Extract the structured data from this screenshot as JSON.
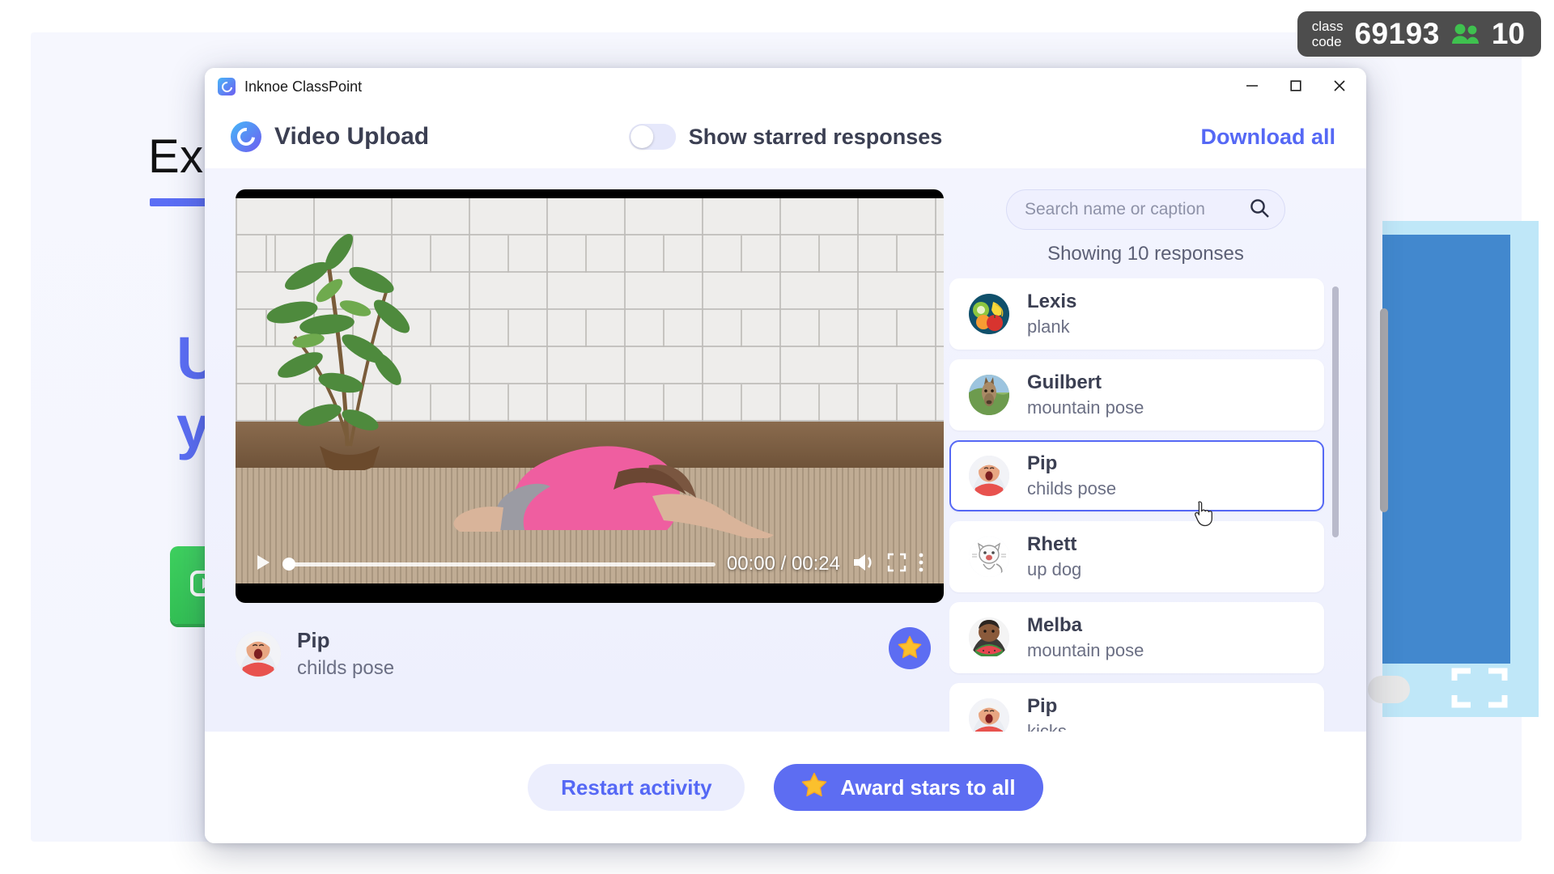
{
  "class_badge": {
    "label_line1": "class",
    "label_line2": "code",
    "code": "69193",
    "participant_icon": "people-icon",
    "participant_count": "10",
    "accent_green": "#3fc14f",
    "background": "#4d4d4d"
  },
  "slide": {
    "title": "Exam",
    "heading": "Up\nyo",
    "video_button_icon": "video-camera-play-icon",
    "accent_blue": "#5b6ef5",
    "green": "#3ed15f",
    "panel_blue": "#4288ce",
    "panel_light_blue": "#bfe7f8",
    "expand_icon": "expand-fullscreen-icon"
  },
  "window": {
    "app_icon": "classpoint-logo-icon",
    "title": "Inknoe ClassPoint",
    "minimize_icon": "minimize-icon",
    "maximize_icon": "maximize-icon",
    "close_icon": "close-icon"
  },
  "header": {
    "activity_icon": "classpoint-logo-icon",
    "activity_title": "Video Upload",
    "toggle_label": "Show starred responses",
    "toggle_state": "off",
    "download_all_label": "Download all",
    "accent": "#5568f5"
  },
  "video": {
    "current_time": "00:00",
    "duration": "00:24",
    "time_display": "00:00 / 00:24",
    "progress_percent": 0,
    "play_icon": "play-icon",
    "volume_icon": "volume-icon",
    "fullscreen_icon": "fullscreen-icon",
    "more_icon": "more-vertical-icon",
    "caption": {
      "avatar": "avatar-pip",
      "name": "Pip",
      "text": "childs pose",
      "star_button_icon": "star-icon"
    }
  },
  "responses_panel": {
    "search_placeholder": "Search name or caption",
    "search_value": "",
    "search_icon": "search-icon",
    "showing_label": "Showing 10 responses",
    "items": [
      {
        "name": "Lexis",
        "caption": "plank",
        "avatar": "avatar-fruit",
        "selected": false
      },
      {
        "name": "Guilbert",
        "caption": "mountain pose",
        "avatar": "avatar-llama",
        "selected": false
      },
      {
        "name": "Pip",
        "caption": "childs pose",
        "avatar": "avatar-pip",
        "selected": true
      },
      {
        "name": "Rhett",
        "caption": "up dog",
        "avatar": "avatar-cat",
        "selected": false
      },
      {
        "name": "Melba",
        "caption": "mountain pose",
        "avatar": "avatar-watermelon",
        "selected": false
      },
      {
        "name": "Pip",
        "caption": "kicks",
        "avatar": "avatar-pip",
        "selected": false
      }
    ]
  },
  "footer": {
    "restart_label": "Restart activity",
    "award_label": "Award stars to all",
    "award_icon": "star-icon"
  },
  "cursor": {
    "icon": "pointing-hand-cursor"
  }
}
